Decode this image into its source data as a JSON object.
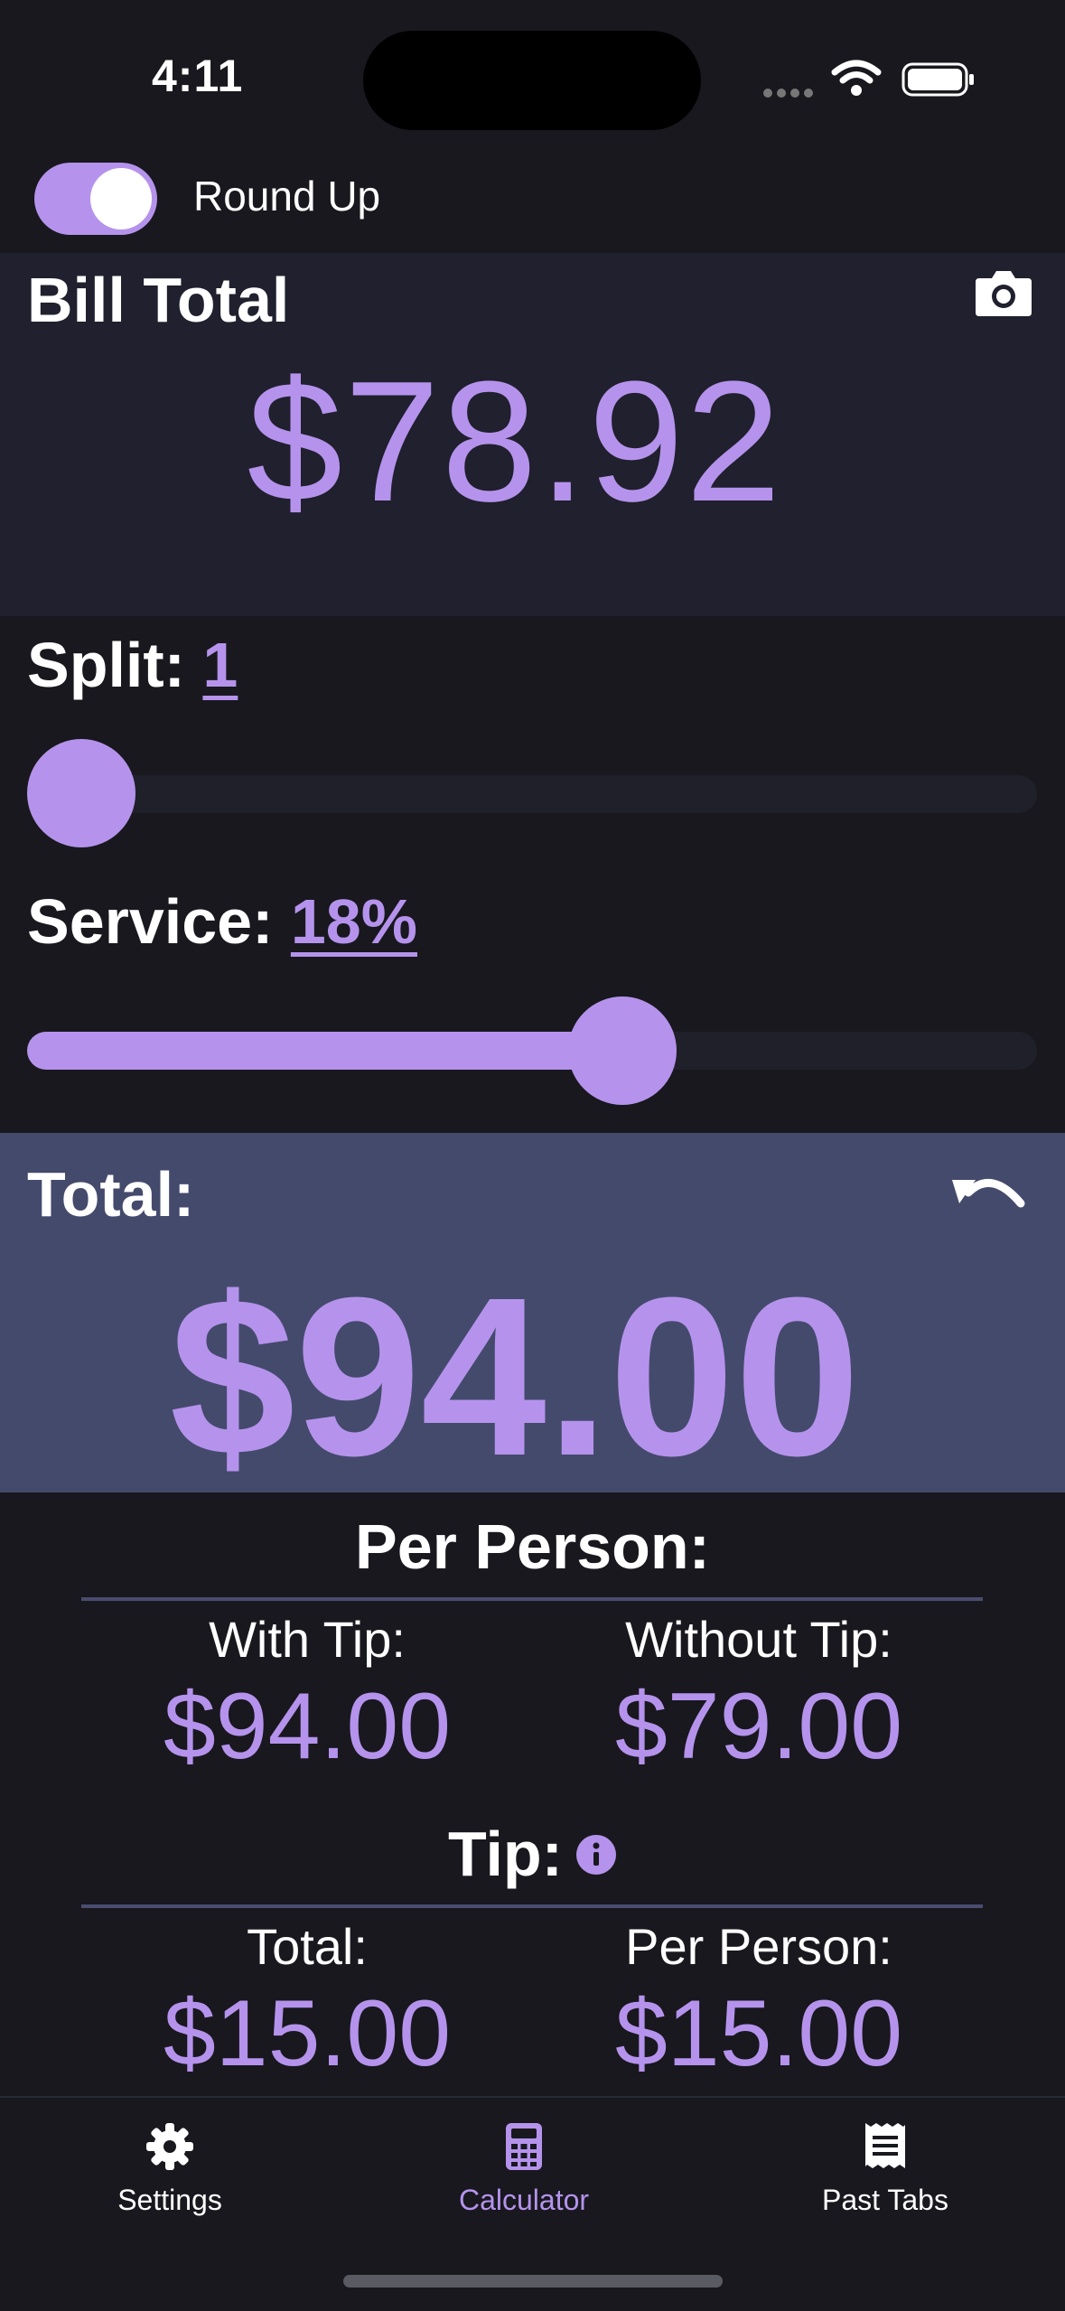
{
  "status_bar": {
    "time": "4:11"
  },
  "toggle": {
    "label": "Round Up",
    "on": true
  },
  "bill": {
    "title": "Bill Total",
    "amount": "$78.92"
  },
  "split": {
    "label": "Split:",
    "value": "1",
    "slider_level": 0.0
  },
  "service": {
    "label": "Service:",
    "value": "18%",
    "slider_level": 0.6
  },
  "total": {
    "title": "Total:",
    "amount": "$94.00"
  },
  "per_person": {
    "title": "Per Person:",
    "with_tip_label": "With Tip:",
    "with_tip_value": "$94.00",
    "without_tip_label": "Without Tip:",
    "without_tip_value": "$79.00"
  },
  "tip": {
    "title": "Tip:",
    "total_label": "Total:",
    "total_value": "$15.00",
    "per_person_label": "Per Person:",
    "per_person_value": "$15.00"
  },
  "tabs": [
    {
      "label": "Settings",
      "icon": "gear-icon",
      "active": false
    },
    {
      "label": "Calculator",
      "icon": "calculator-icon",
      "active": true
    },
    {
      "label": "Past Tabs",
      "icon": "receipt-icon",
      "active": false
    }
  ],
  "colors": {
    "accent": "#b593ec",
    "background": "#18181e",
    "bill_panel": "#20202e",
    "total_panel": "#444a6c"
  }
}
